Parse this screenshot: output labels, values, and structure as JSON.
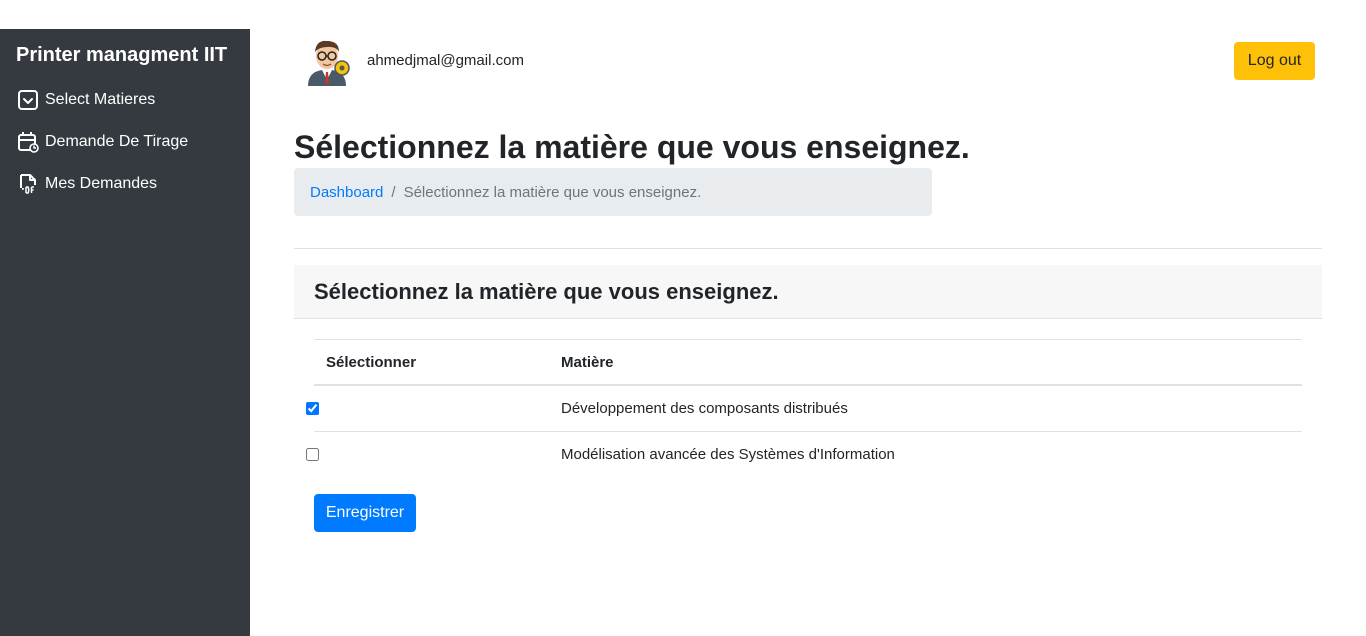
{
  "sidebar": {
    "brand": "Printer managment IIT",
    "items": [
      {
        "label": "Select Matieres",
        "icon": "checkbox-square-icon"
      },
      {
        "label": "Demande De Tirage",
        "icon": "calendar-refresh-icon"
      },
      {
        "label": "Mes Demandes",
        "icon": "pdf-file-icon"
      }
    ]
  },
  "header": {
    "email": "ahmedjmal@gmail.com",
    "logout_label": "Log out"
  },
  "page": {
    "title": "Sélectionnez la matière que vous enseignez.",
    "breadcrumb": {
      "link": "Dashboard",
      "separator": "/",
      "current": "Sélectionnez la matière que vous enseignez."
    }
  },
  "card": {
    "title": "Sélectionnez la matière que vous enseignez.",
    "table": {
      "headers": [
        "Sélectionner",
        "Matière"
      ],
      "rows": [
        {
          "checked": true,
          "subject": "Développement des composants distribués"
        },
        {
          "checked": false,
          "subject": "Modélisation avancée des Systèmes d'Information"
        }
      ]
    },
    "save_label": "Enregistrer"
  },
  "colors": {
    "sidebar_bg": "#343a40",
    "primary": "#007bff",
    "warning": "#ffc107"
  }
}
